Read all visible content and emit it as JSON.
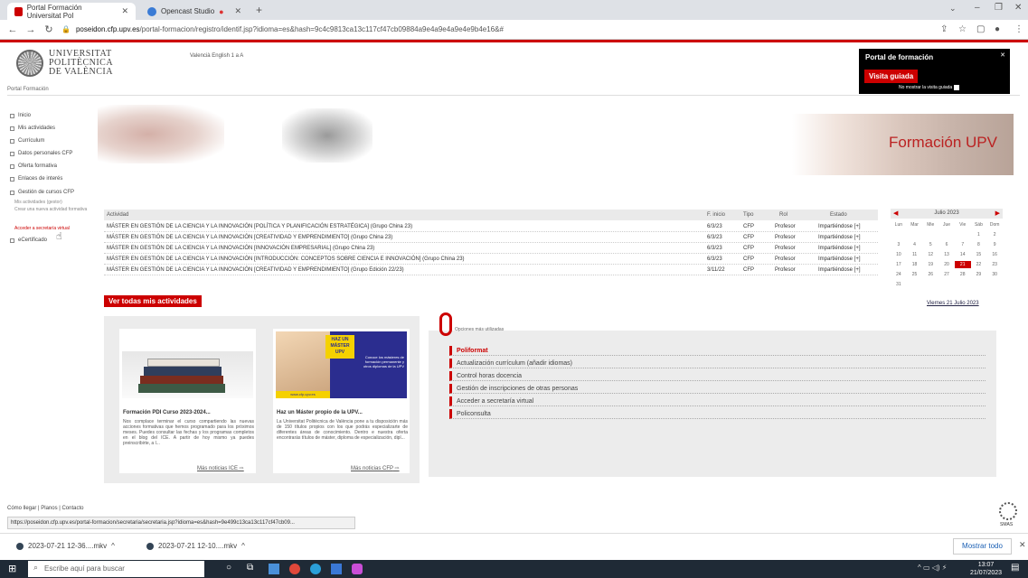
{
  "browser": {
    "tabs": [
      {
        "label": "Portal Formación Universitat Pol"
      },
      {
        "label": "Opencast Studio"
      }
    ],
    "url_domain": "poseidon.cfp.upv.es",
    "url_path": "/portal-formacion/registro/identif.jsp?idioma=es&hash=9c4c9813ca13c117cf47cb09884a9e4a9e4a9e4e9b4e16&#"
  },
  "header": {
    "logo_line1": "UNIVERSITAT",
    "logo_line2": "POLITÈCNICA",
    "logo_line3": "DE VALÈNCIA",
    "languages": "Valencià  English  1  a  A",
    "breadcrumb": "Portal Formación"
  },
  "popup": {
    "title": "Portal de formación",
    "button": "Visita guiada",
    "checkbox_label": "No mostrar la visita guiada"
  },
  "sidebar": {
    "items": [
      {
        "label": "Inicio"
      },
      {
        "label": "Mis actividades"
      },
      {
        "label": "Currículum"
      },
      {
        "label": "Datos personales CFP"
      },
      {
        "label": "Oferta formativa"
      },
      {
        "label": "Enlaces de interés"
      },
      {
        "label": "Gestión de cursos CFP"
      },
      {
        "label": "eCertificado"
      }
    ],
    "subitems": [
      {
        "label": "Mis actividades (gestor)"
      },
      {
        "label": "Crear una nueva actividad formativa"
      },
      {
        "label": "Acceder a secretaría virtual"
      }
    ]
  },
  "banner": {
    "title": "Formación UPV"
  },
  "activities": {
    "headers": {
      "actividad": "Actividad",
      "inicio": "F. inicio",
      "tipo": "Tipo",
      "rol": "Rol",
      "estado": "Estado"
    },
    "rows": [
      {
        "actividad": "MÁSTER EN GESTIÓN DE LA CIENCIA Y LA INNOVACIÓN [POLÍTICA Y PLANIFICACIÓN ESTRATÉGICA] (Grupo China 23)",
        "inicio": "6/3/23",
        "tipo": "CFP",
        "rol": "Profesor",
        "estado": "Impartiéndose [+]"
      },
      {
        "actividad": "MÁSTER EN GESTIÓN DE LA CIENCIA Y LA INNOVACIÓN [CREATIVIDAD Y EMPRENDIMIENTO] (Grupo China 23)",
        "inicio": "6/3/23",
        "tipo": "CFP",
        "rol": "Profesor",
        "estado": "Impartiéndose [+]"
      },
      {
        "actividad": "MÁSTER EN GESTIÓN DE LA CIENCIA Y LA INNOVACIÓN [INNOVACIÓN EMPRESARIAL] (Grupo China 23)",
        "inicio": "6/3/23",
        "tipo": "CFP",
        "rol": "Profesor",
        "estado": "Impartiéndose [+]"
      },
      {
        "actividad": "MÁSTER EN GESTIÓN DE LA CIENCIA Y LA INNOVACIÓN [INTRODUCCIÓN: CONCEPTOS SOBRE CIENCIA E INNOVACIÓN] (Grupo China 23)",
        "inicio": "6/3/23",
        "tipo": "CFP",
        "rol": "Profesor",
        "estado": "Impartiéndose [+]"
      },
      {
        "actividad": "MÁSTER EN GESTIÓN DE LA CIENCIA Y LA INNOVACIÓN [CREATIVIDAD Y EMPRENDIMIENTO] (Grupo Edición 22/23)",
        "inicio": "3/11/22",
        "tipo": "CFP",
        "rol": "Profesor",
        "estado": "Impartiéndose [+]"
      }
    ],
    "see_all": "Ver todas mis actividades"
  },
  "calendar": {
    "month": "Julio 2023",
    "weekdays": [
      "Lun",
      "Mar",
      "Mie",
      "Jue",
      "Vie",
      "Sáb",
      "Dom"
    ],
    "days": [
      "",
      "",
      "",
      "",
      "",
      "1",
      "2",
      "3",
      "4",
      "5",
      "6",
      "7",
      "8",
      "9",
      "10",
      "11",
      "12",
      "13",
      "14",
      "15",
      "16",
      "17",
      "18",
      "19",
      "20",
      "21",
      "22",
      "23",
      "24",
      "25",
      "26",
      "27",
      "28",
      "29",
      "30",
      "31"
    ],
    "today": "21",
    "footer": "Viernes 21 Julio 2023"
  },
  "news": [
    {
      "title": "Formación PDI Curso 2023-2024...",
      "body": "Nos complace terminar el curso compartiendo las nuevas acciones formativas que hemos programado para los próximos meses. Puedes consultar las fechas y los programas completos en el blog del ICE. A partir de hoy mismo ya puedes preinscribirte, a l...",
      "link": "Más noticias ICE"
    },
    {
      "title": "Haz un Máster propio de la UPV...",
      "body": "La Universitat Politècnica de València pone a tu disposición más de 150 títulos propios con los que podrás especializarte de diferentes áreas de conocimiento. Dentro e nuestra oferta encontrarás títulos de máster, diploma de especialización, dipl...",
      "link": "Más noticias CFP",
      "promo_big": "HAZ UN MÁSTER UPV",
      "promo_text": "Conoce los másteres de formación permanente y otros diplomas de la UPV",
      "promo_url": "www.cfp.upv.es"
    }
  ],
  "options": {
    "title": "Opciones más utilizadas",
    "items": [
      "Poliformat",
      "Actualización currículum (añadir idiomas)",
      "Control horas docencia",
      "Gestión de inscripciones de otras personas",
      "Acceder a secretaría virtual",
      "Policonsulta"
    ]
  },
  "footer": {
    "links": "Cómo llegar | Planos | Contacto",
    "status_url": "https://poseidon.cfp.upv.es/portal-formacion/secretaria/secretaria.jsp?idioma=es&hash=9e499c13ca13c117cf47cb09...",
    "smas": "SMAS"
  },
  "downloads": [
    {
      "name": "2023-07-21 12-36....mkv"
    },
    {
      "name": "2023-07-21 12-10....mkv"
    }
  ],
  "show_all": "Mostrar todo",
  "taskbar": {
    "search": "Escribe aquí para buscar",
    "time": "13:07",
    "date": "21/07/2023"
  },
  "colors": {
    "brand_red": "#cc0000",
    "taskbar": "#1f2a36"
  }
}
